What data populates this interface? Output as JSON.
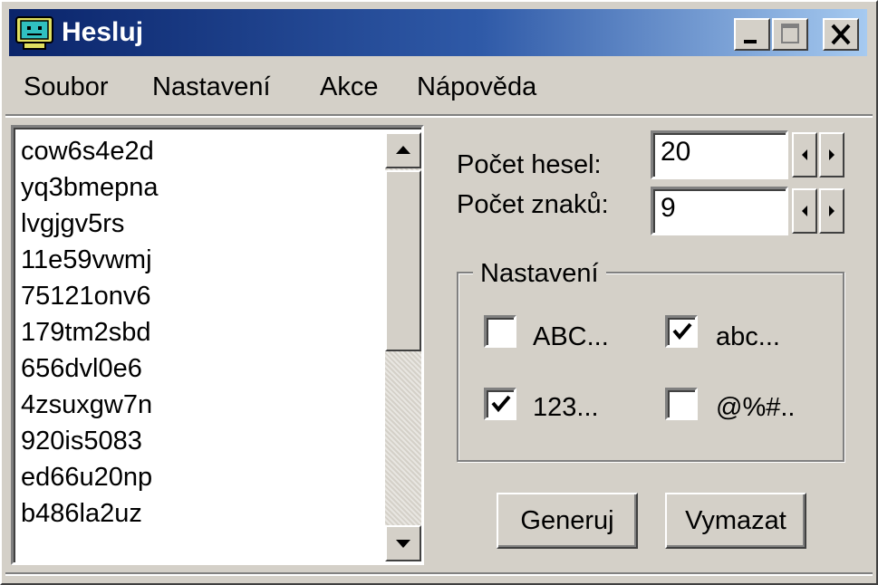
{
  "window": {
    "title": "Hesluj",
    "icon": "app-monitor-icon",
    "controls": {
      "minimize": "minimize-icon",
      "maximize": "maximize-icon",
      "close": "close-icon"
    }
  },
  "menu": {
    "items": [
      "Soubor",
      "Nastavení",
      "Akce",
      "Nápověda"
    ]
  },
  "passwords": {
    "items": [
      "cow6s4e2d",
      "yq3bmepna",
      "lvgjgv5rs",
      "11e59vwmj",
      "75121onv6",
      "179tm2sbd",
      "656dvl0e6",
      "4zsuxgw7n",
      "920is5083",
      "ed66u20np",
      "b486la2uz"
    ]
  },
  "settings": {
    "count_label": "Počet hesel:",
    "count_value": "20",
    "length_label": "Počet znaků:",
    "length_value": "9"
  },
  "options": {
    "title": "Nastavení",
    "uppercase_label": "ABC...",
    "uppercase_checked": false,
    "lowercase_label": "abc...",
    "lowercase_checked": true,
    "digits_label": "123...",
    "digits_checked": true,
    "symbols_label": "@%#..",
    "symbols_checked": false
  },
  "actions": {
    "generate_label": "Generuj",
    "clear_label": "Vymazat"
  },
  "colors": {
    "titlebar_start": "#0a246a",
    "titlebar_end": "#a6caf0",
    "face": "#d4d0c8"
  }
}
